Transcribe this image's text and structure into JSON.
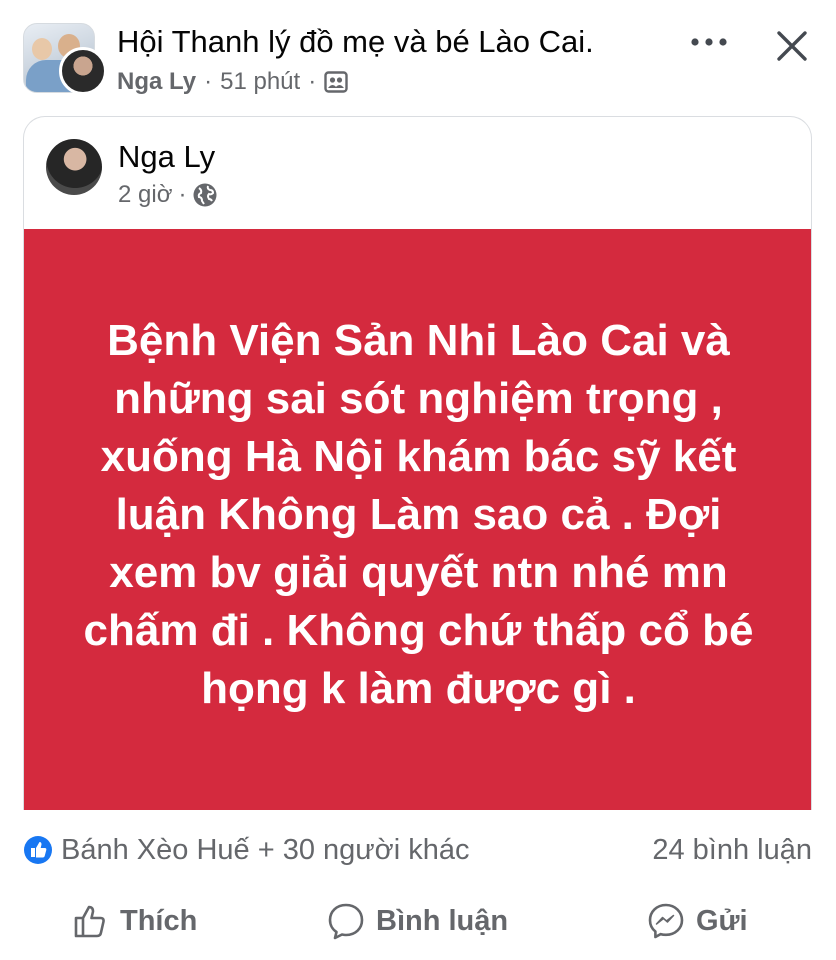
{
  "header": {
    "group_name": "Hội Thanh lý đồ mẹ và bé Lào Cai.",
    "author": "Nga Ly",
    "separator": "·",
    "time": "51 phút"
  },
  "shared_post": {
    "author": "Nga Ly",
    "time": "2 giờ",
    "separator": "·",
    "text": "Bệnh Viện Sản Nhi Lào Cai và những sai sót nghiệm trọng , xuống Hà Nội khám bác sỹ kết luận Không Làm sao cả . Đợi xem bv giải quyết ntn nhé mn chấm đi . Không chứ thấp cổ bé họng k làm được gì .",
    "background_color": "#d42a3e"
  },
  "reactions": {
    "names": "Bánh Xèo Huế + 30 người khác",
    "comments": "24 bình luận",
    "icon": "like-icon",
    "accent": "#1877f2"
  },
  "actions": {
    "like": "Thích",
    "comment": "Bình luận",
    "send": "Gửi"
  },
  "icons": {
    "more": "more-horizontal-icon",
    "close": "close-icon",
    "audience_header": "group-members-icon",
    "audience_post": "globe-icon"
  }
}
